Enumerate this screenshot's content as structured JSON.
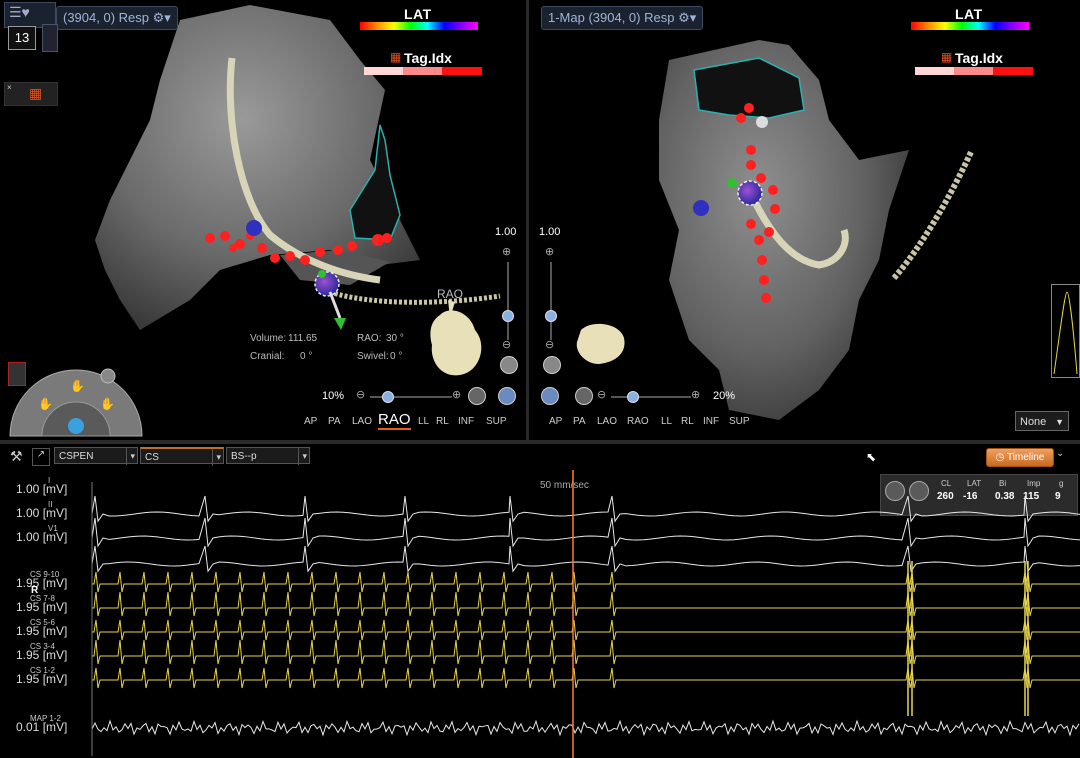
{
  "left_view": {
    "map_title": "(3904, 0) Resp",
    "lat_label": "LAT",
    "tag_label": "Tag.Idx",
    "counter": "13",
    "orientation_label": "RAO",
    "zoom": "10%",
    "slider_top": "1.00",
    "info": {
      "volume_label": "Volume:",
      "volume_value": "111.65",
      "rao_label": "RAO:",
      "rao_value": "30 °",
      "cranial_label": "Cranial:",
      "cranial_value": "0 °",
      "swivel_label": "Swivel:",
      "swivel_value": "0 °"
    },
    "view_buttons": [
      "AP",
      "PA",
      "LAO",
      "RAO",
      "LL",
      "RL",
      "INF",
      "SUP"
    ],
    "active_view": "RAO"
  },
  "right_view": {
    "map_title": "1-Map (3904, 0) Resp",
    "lat_label": "LAT",
    "tag_label": "Tag.Idx",
    "zoom": "20%",
    "slider_top": "1.00",
    "view_buttons": [
      "AP",
      "PA",
      "LAO",
      "RAO",
      "LL",
      "RL",
      "INF",
      "SUP"
    ],
    "dropdown_value": "None"
  },
  "signals": {
    "toolbar": {
      "select1": "CSPEN",
      "select2": "CS",
      "select3": "BS--p",
      "timeline_label": "Timeline"
    },
    "sweep_speed": "50 mm/sec",
    "stats": {
      "headers": [
        "CL",
        "LAT",
        "Bi",
        "Imp",
        "g"
      ],
      "values": [
        "260",
        "-16",
        "0.38",
        "115",
        "9"
      ]
    },
    "leads": [
      {
        "scale": "1.00 [mV]",
        "name": "I"
      },
      {
        "scale": "1.00 [mV]",
        "name": "II"
      },
      {
        "scale": "1.00 [mV]",
        "name": "V1"
      },
      {
        "scale": "1.95 [mV]",
        "name": "CS 9-10"
      },
      {
        "scale": "1.95 [mV]",
        "name": "CS 7-8"
      },
      {
        "scale": "1.95 [mV]",
        "name": "CS 5-6"
      },
      {
        "scale": "1.95 [mV]",
        "name": "CS 3-4"
      },
      {
        "scale": "1.95 [mV]",
        "name": "CS 1-2"
      },
      {
        "scale": "0.01 [mV]",
        "name": "MAP 1-2"
      }
    ],
    "marker_r": "R"
  },
  "colors": {
    "ecg": "#e8e8e8",
    "cs": "#e8d44a",
    "cursor": "#ff7a30",
    "ablation_tag": "#ff2020",
    "mesh_outline": "#2bb0b0",
    "anatomy_shell": "#7a7a7a"
  }
}
